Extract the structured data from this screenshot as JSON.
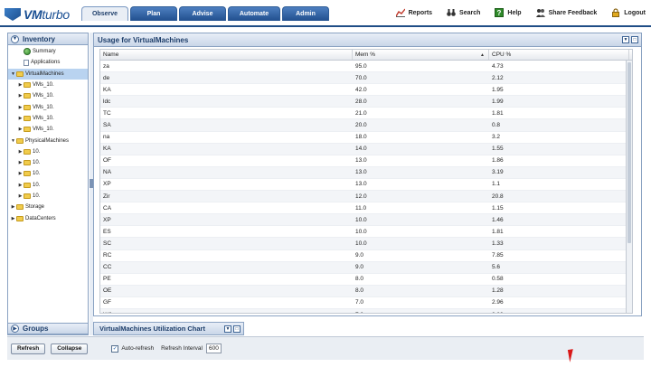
{
  "app": {
    "logo_text_bold": "VM",
    "logo_text_thin": "turbo"
  },
  "tabs": [
    {
      "label": "Observe",
      "active": true
    },
    {
      "label": "Plan",
      "active": false
    },
    {
      "label": "Advise",
      "active": false
    },
    {
      "label": "Automate",
      "active": false
    },
    {
      "label": "Admin",
      "active": false
    }
  ],
  "tools": [
    {
      "label": "Reports",
      "icon": "reports-chart-icon"
    },
    {
      "label": "Search",
      "icon": "binoculars-icon"
    },
    {
      "label": "Help",
      "icon": "help-icon"
    },
    {
      "label": "Share Feedback",
      "icon": "feedback-icon"
    },
    {
      "label": "Logout",
      "icon": "lock-icon"
    }
  ],
  "inventory": {
    "title": "Inventory",
    "nodes": [
      {
        "label": "Summary",
        "icon": "globe-icon",
        "indent": 1,
        "arrow": "",
        "selected": false
      },
      {
        "label": "Applications",
        "icon": "document-icon",
        "indent": 1,
        "arrow": "",
        "selected": false
      },
      {
        "label": "VirtualMachines",
        "icon": "folder-icon",
        "indent": 0,
        "arrow": "▼",
        "selected": true
      },
      {
        "label": "VMs_10.",
        "icon": "folder-icon",
        "indent": 1,
        "arrow": "▶",
        "selected": false
      },
      {
        "label": "VMs_10.",
        "icon": "folder-icon",
        "indent": 1,
        "arrow": "▶",
        "selected": false
      },
      {
        "label": "VMs_10.",
        "icon": "folder-icon",
        "indent": 1,
        "arrow": "▶",
        "selected": false
      },
      {
        "label": "VMs_10.",
        "icon": "folder-icon",
        "indent": 1,
        "arrow": "▶",
        "selected": false
      },
      {
        "label": "VMs_10.",
        "icon": "folder-icon",
        "indent": 1,
        "arrow": "▶",
        "selected": false
      },
      {
        "label": "PhysicalMachines",
        "icon": "folder-icon",
        "indent": 0,
        "arrow": "▼",
        "selected": false
      },
      {
        "label": "10.",
        "icon": "folder-icon",
        "indent": 1,
        "arrow": "▶",
        "selected": false
      },
      {
        "label": "10.",
        "icon": "folder-icon",
        "indent": 1,
        "arrow": "▶",
        "selected": false
      },
      {
        "label": "10.",
        "icon": "folder-icon",
        "indent": 1,
        "arrow": "▶",
        "selected": false
      },
      {
        "label": "10.",
        "icon": "folder-icon",
        "indent": 1,
        "arrow": "▶",
        "selected": false
      },
      {
        "label": "10.",
        "icon": "folder-icon",
        "indent": 1,
        "arrow": "▶",
        "selected": false
      },
      {
        "label": "Storage",
        "icon": "folder-icon",
        "indent": 0,
        "arrow": "▶",
        "selected": false
      },
      {
        "label": "DataCenters",
        "icon": "folder-icon",
        "indent": 0,
        "arrow": "▶",
        "selected": false
      }
    ]
  },
  "groups": {
    "title": "Groups"
  },
  "usage": {
    "title": "Usage for VirtualMachines",
    "columns": [
      "Name",
      "Mem %",
      "CPU %"
    ],
    "rows": [
      [
        "za",
        "95.0",
        "4.73"
      ],
      [
        "de",
        "70.0",
        "2.12"
      ],
      [
        "KA",
        "42.0",
        "1.95"
      ],
      [
        "ldc",
        "28.0",
        "1.99"
      ],
      [
        "TC",
        "21.0",
        "1.81"
      ],
      [
        "SA",
        "20.0",
        "0.8"
      ],
      [
        "na",
        "18.0",
        "3.2"
      ],
      [
        "KA",
        "14.0",
        "1.55"
      ],
      [
        "OF",
        "13.0",
        "1.86"
      ],
      [
        "NA",
        "13.0",
        "3.19"
      ],
      [
        "XP",
        "13.0",
        "1.1"
      ],
      [
        "Zir",
        "12.0",
        "20.8"
      ],
      [
        "CA",
        "11.0",
        "1.15"
      ],
      [
        "XP",
        "10.0",
        "1.46"
      ],
      [
        "ES",
        "10.0",
        "1.81"
      ],
      [
        "SC",
        "10.0",
        "1.33"
      ],
      [
        "RC",
        "9.0",
        "7.85"
      ],
      [
        "CC",
        "9.0",
        "5.6"
      ],
      [
        "PE",
        "8.0",
        "0.58"
      ],
      [
        "OE",
        "8.0",
        "1.28"
      ],
      [
        "GF",
        "7.0",
        "2.96"
      ],
      [
        "W2",
        "7.0",
        "3.89"
      ]
    ]
  },
  "chart_panel": {
    "title": "VirtualMachines Utilization Chart"
  },
  "bottom": {
    "refresh": "Refresh",
    "collapse": "Collapse",
    "auto_refresh": "Auto-refresh",
    "interval_label": "Refresh Interval",
    "interval_value": "600"
  }
}
